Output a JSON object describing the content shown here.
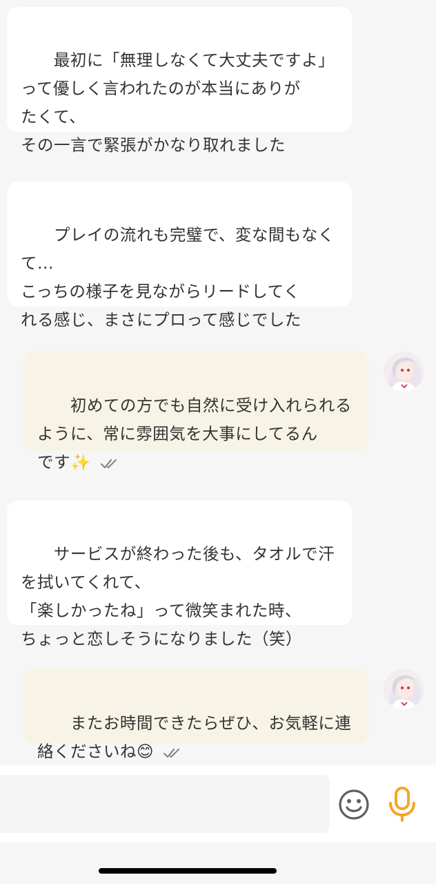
{
  "messages": [
    {
      "direction": "incoming",
      "text": "最初に「無理しなくて大丈夫ですよ」\nって優しく言われたのが本当にありが\nたくて、\nその一言で緊張がかなり取れました"
    },
    {
      "direction": "incoming",
      "text": "プレイの流れも完璧で、変な間もなく\nて...\nこっちの様子を見ながらリードしてく\nれる感じ、まさにプロって感じでした"
    },
    {
      "direction": "outgoing",
      "text": "初めての方でも自然に受け入れられる\nように、常に雰囲気を大事にしてるん\nです✨",
      "status_icon": "double-check-icon"
    },
    {
      "direction": "incoming",
      "text": "サービスが終わった後も、タオルで汗\nを拭いてくれて、\n「楽しかったね」って微笑まれた時、\nちょっと恋しそうになりました（笑）"
    },
    {
      "direction": "outgoing",
      "text": "またお時間できたらぜひ、お気軽に連\n絡くださいね😊",
      "status_icon": "double-check-icon"
    }
  ],
  "input": {
    "value": "",
    "emoji_icon": "smiley-icon",
    "mic_icon": "microphone-icon"
  },
  "colors": {
    "background": "#f6f6f6",
    "incoming_bubble": "#ffffff",
    "outgoing_bubble": "#f7f3e6",
    "mic_accent": "#f5a623",
    "text": "#333333"
  }
}
